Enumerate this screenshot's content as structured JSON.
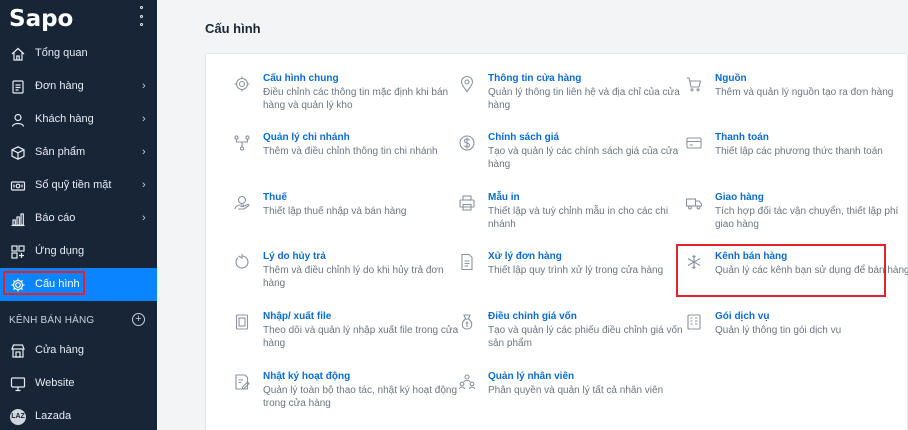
{
  "app": {
    "logo": "Sapo"
  },
  "sidebar": {
    "items": [
      {
        "label": "Tổng quan",
        "icon": "home-icon",
        "chevron": ""
      },
      {
        "label": "Đơn hàng",
        "icon": "order-icon",
        "chevron": "›"
      },
      {
        "label": "Khách hàng",
        "icon": "user-icon",
        "chevron": "›"
      },
      {
        "label": "Sản phẩm",
        "icon": "box-icon",
        "chevron": "›"
      },
      {
        "label": "Sổ quỹ tiền mặt",
        "icon": "cash-icon",
        "chevron": "›"
      },
      {
        "label": "Báo cáo",
        "icon": "chart-icon",
        "chevron": "›"
      },
      {
        "label": "Ứng dụng",
        "icon": "apps-icon",
        "chevron": ""
      },
      {
        "label": "Cấu hình",
        "icon": "settings-icon",
        "chevron": ""
      }
    ],
    "sales_channels_header": "KÊNH BÁN HÀNG",
    "sales_channels_add": "+",
    "channels": [
      {
        "label": "Cửa hàng",
        "icon": "store-icon"
      },
      {
        "label": "Website",
        "icon": "monitor-icon"
      },
      {
        "label": "Lazada",
        "icon": "lazada-icon",
        "badge": "LAZ"
      }
    ],
    "accent_color": "#0a84ff",
    "background_color": "#182537"
  },
  "main": {
    "title": "Cấu hình",
    "settings": [
      {
        "title": "Cấu hình chung",
        "desc": "Điều chỉnh các thông tin mặc định khi bán hàng và quản lý kho",
        "icon": "gear-icon"
      },
      {
        "title": "Thông tin cửa hàng",
        "desc": "Quản lý thông tin liên hệ và địa chỉ của cửa hàng",
        "icon": "location-icon"
      },
      {
        "title": "Nguồn",
        "desc": "Thêm và quản lý nguồn tạo ra đơn hàng",
        "icon": "cart-icon"
      },
      {
        "title": "Quản lý chi nhánh",
        "desc": "Thêm và điều chỉnh thông tin chi nhánh",
        "icon": "branch-icon"
      },
      {
        "title": "Chính sách giá",
        "desc": "Tạo và quản lý các chính sách giá của cửa hàng",
        "icon": "dollar-icon"
      },
      {
        "title": "Thanh toán",
        "desc": "Thiết lập các phương thức thanh toán",
        "icon": "card-icon"
      },
      {
        "title": "Thuế",
        "desc": "Thiết lập thuế nhập và bán hàng",
        "icon": "tax-icon"
      },
      {
        "title": "Mẫu in",
        "desc": "Thiết lập và tuỳ chỉnh mẫu in cho các chi nhánh",
        "icon": "printer-icon"
      },
      {
        "title": "Giao hàng",
        "desc": "Tích hợp đối tác vận chuyển, thiết lập phí giao hàng",
        "icon": "truck-icon"
      },
      {
        "title": "Lý do hủy trả",
        "desc": "Thêm và điều chỉnh lý do khi hủy trả đơn hàng",
        "icon": "undo-icon"
      },
      {
        "title": "Xử lý đơn hàng",
        "desc": "Thiết lập quy trình xử lý trong cửa hàng",
        "icon": "document-icon"
      },
      {
        "title": "Kênh bán hàng",
        "desc": "Quản lý các kênh bạn sử dụng để bán hàng",
        "icon": "snowflake-icon"
      },
      {
        "title": "Nhập/ xuất file",
        "desc": "Theo dõi và quản lý nhập xuất file trong cửa hàng",
        "icon": "file-icon"
      },
      {
        "title": "Điều chỉnh giá vốn",
        "desc": "Tạo và quản lý các phiếu điều chỉnh giá vốn sản phẩm",
        "icon": "price-adjust-icon"
      },
      {
        "title": "Gói dịch vụ",
        "desc": "Quản lý thông tin gói dịch vụ",
        "icon": "package-icon"
      },
      {
        "title": "Nhật ký hoạt động",
        "desc": "Quản lý toàn bộ thao tác, nhật ký hoạt động trong cửa hàng",
        "icon": "activity-log-icon"
      },
      {
        "title": "Quản lý nhân viên",
        "desc": "Phân quyền và quản lý tất cả nhân viên",
        "icon": "staff-icon"
      }
    ],
    "link_color": "#0a6bd6",
    "highlight_color": "#e3232c"
  }
}
